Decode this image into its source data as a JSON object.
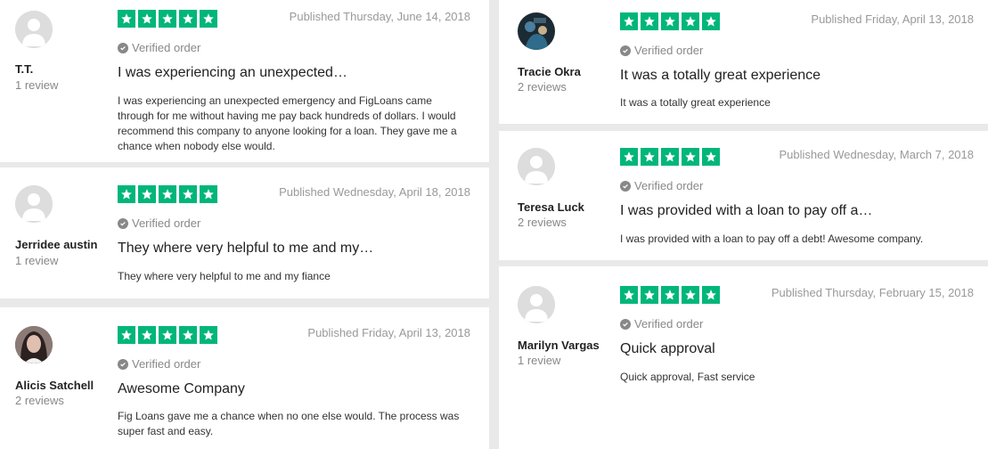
{
  "reviews": [
    {
      "name": "T.T.",
      "review_count": "1 review",
      "published": "Published Thursday, June 14, 2018",
      "verified": "Verified order",
      "title": "I was experiencing an unexpected…",
      "body": "I was experiencing an unexpected emergency and FigLoans came through for me without having me pay back hundreds of dollars. I would recommend this company to anyone looking for a loan. They gave me a chance when nobody else would.",
      "rating": 5
    },
    {
      "name": "Jerridee austin",
      "review_count": "1 review",
      "published": "Published Wednesday, April 18, 2018",
      "verified": "Verified order",
      "title": "They where very helpful to me and my…",
      "body": "They where very helpful to me and my fiance",
      "rating": 5
    },
    {
      "name": "Alicis Satchell",
      "review_count": "2 reviews",
      "published": "Published Friday, April 13, 2018",
      "verified": "Verified order",
      "title": "Awesome Company",
      "body": "Fig Loans gave me a chance when no one else would. The process was super fast and easy.",
      "rating": 5
    },
    {
      "name": "Tracie Okra",
      "review_count": "2 reviews",
      "published": "Published Friday, April 13, 2018",
      "verified": "Verified order",
      "title": "It was a totally great experience",
      "body": "It was a totally great experience",
      "rating": 5
    },
    {
      "name": "Teresa Luck",
      "review_count": "2 reviews",
      "published": "Published Wednesday, March 7, 2018",
      "verified": "Verified order",
      "title": "I was provided with a loan to pay off a…",
      "body": "I was provided with a loan to pay off a debt! Awesome company.",
      "rating": 5
    },
    {
      "name": "Marilyn Vargas",
      "review_count": "1 review",
      "published": "Published Thursday, February 15, 2018",
      "verified": "Verified order",
      "title": "Quick approval",
      "body": "Quick approval, Fast service",
      "rating": 5
    }
  ],
  "colors": {
    "star_green": "#00b67a",
    "background": "#e9e9e9"
  }
}
